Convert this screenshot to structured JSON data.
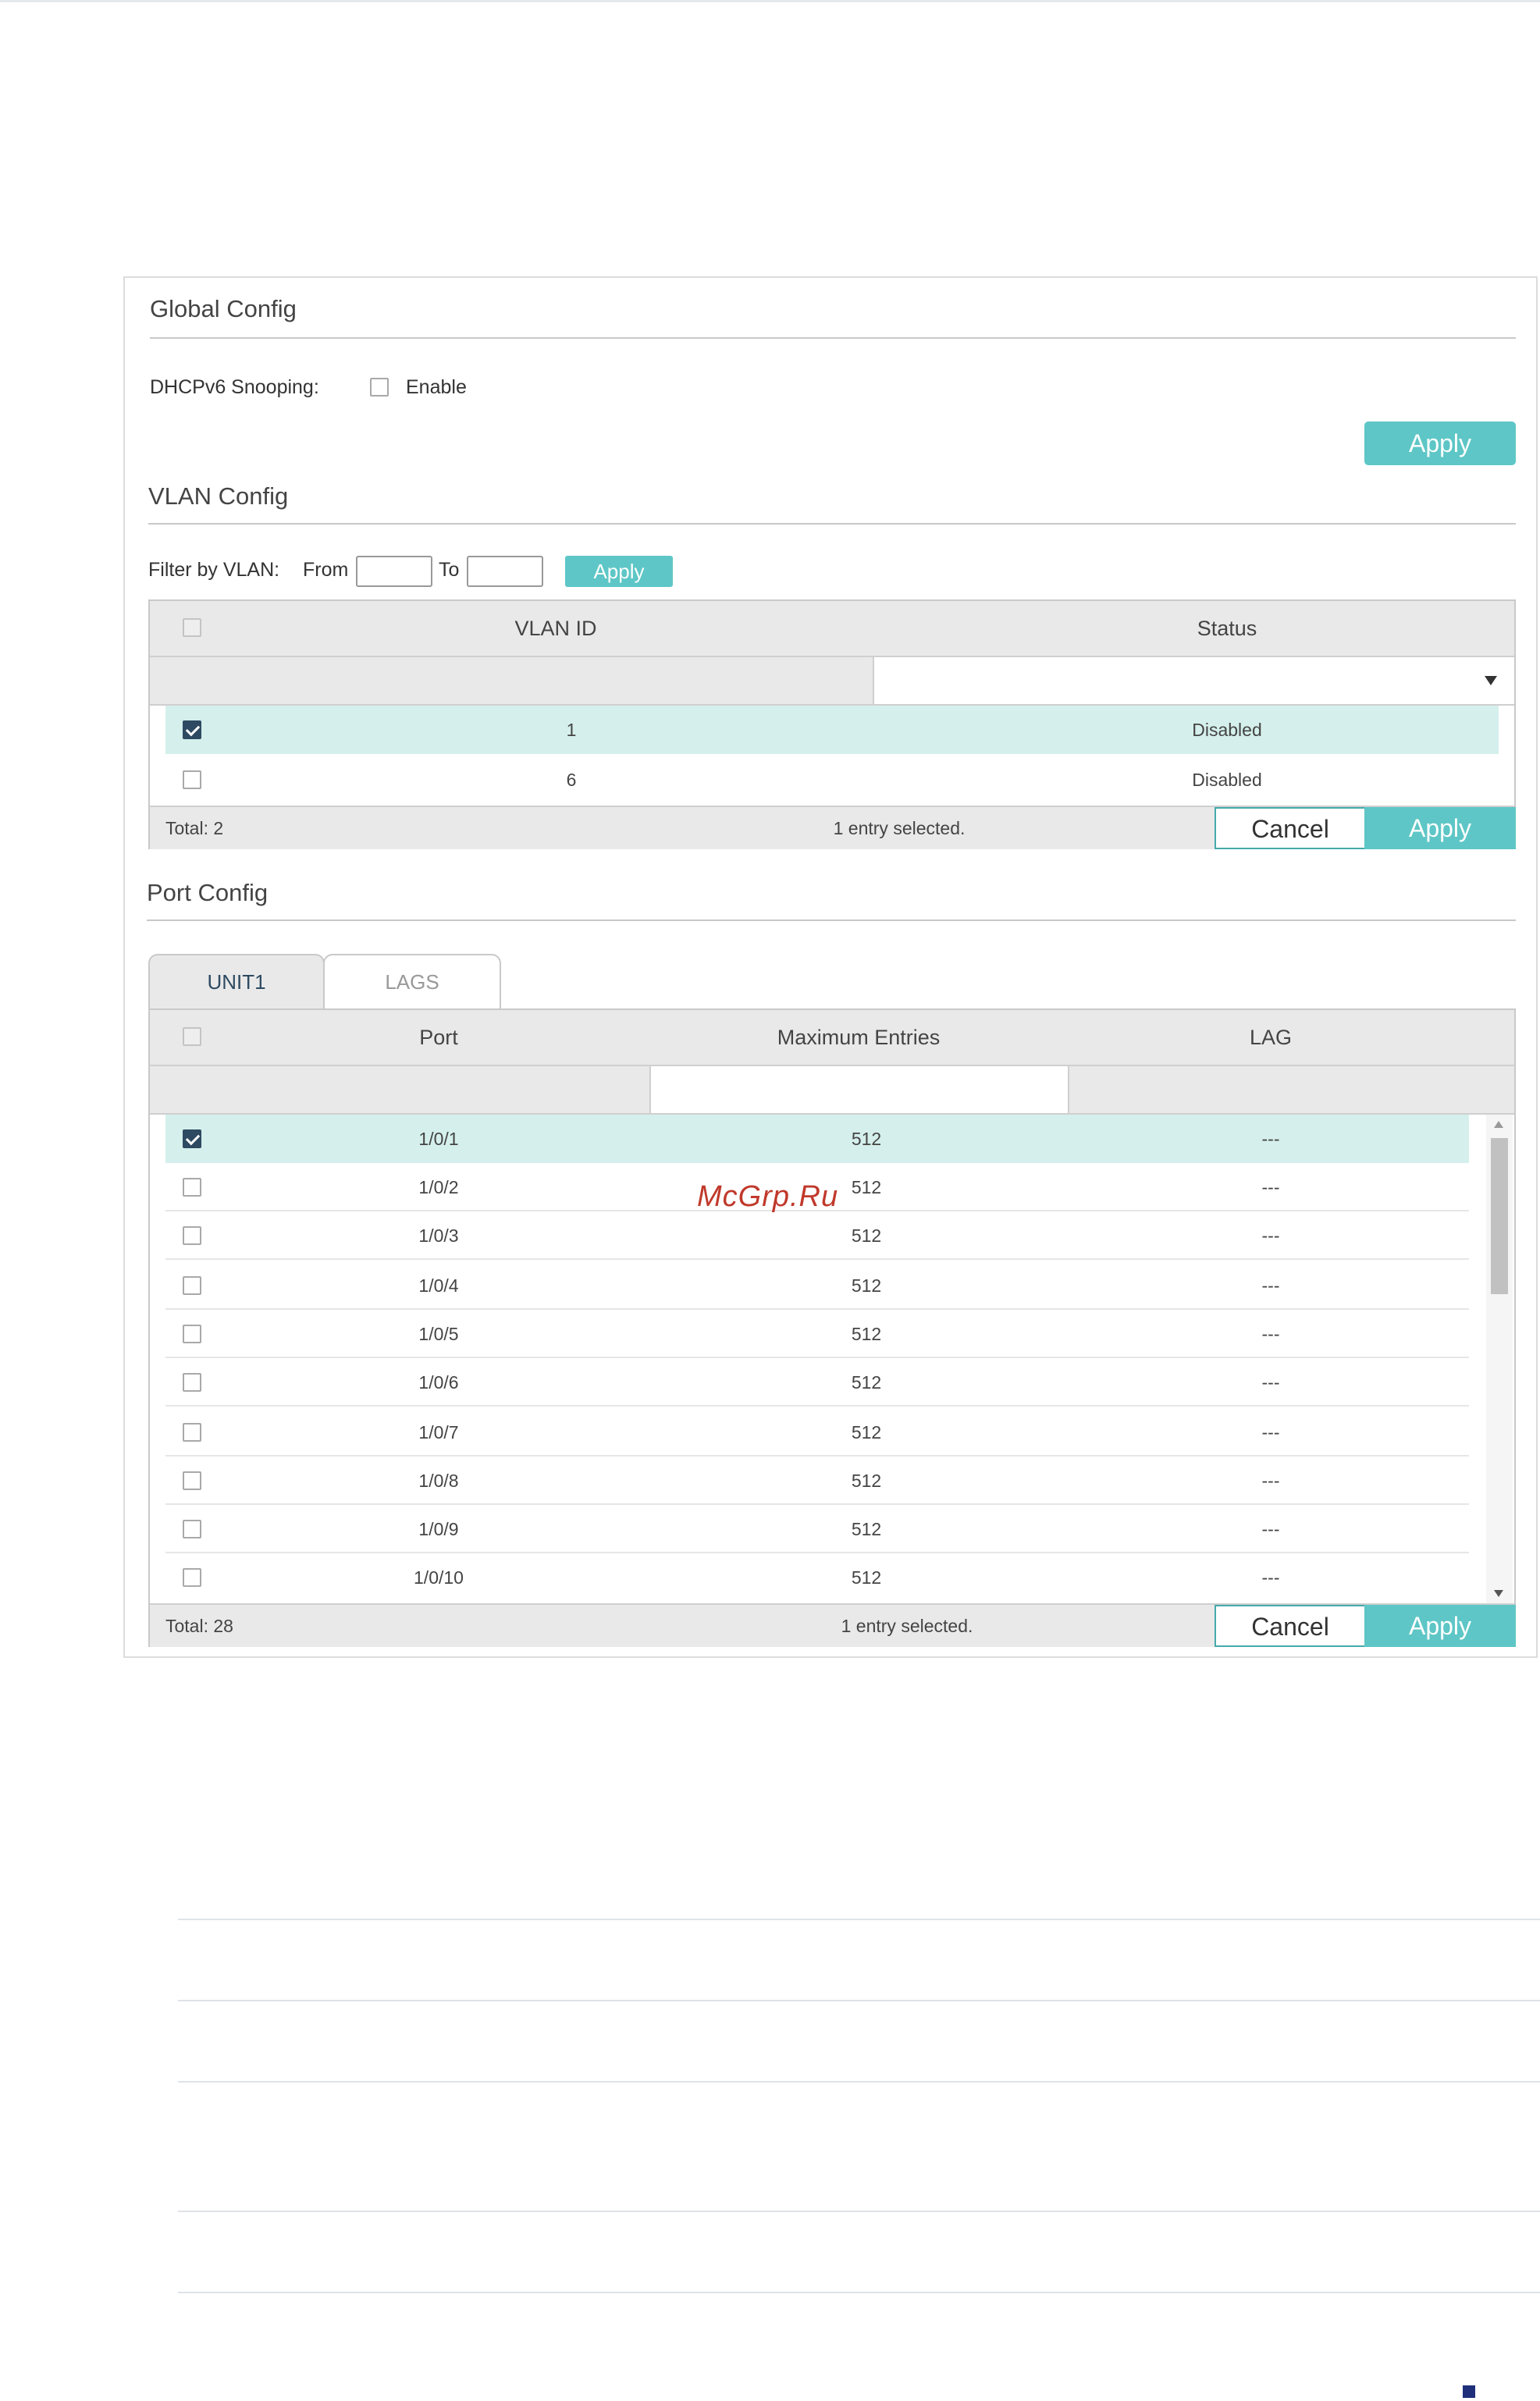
{
  "global_config": {
    "title": "Global Config",
    "dhcpv6_label": "DHCPv6 Snooping:",
    "enable_label": "Enable",
    "enable_checked": false,
    "apply_label": "Apply"
  },
  "vlan_config": {
    "title": "VLAN Config",
    "filter_label": "Filter by VLAN:",
    "from_label": "From",
    "to_label": "To",
    "from_value": "",
    "to_value": "",
    "filter_apply_label": "Apply",
    "columns": [
      "VLAN ID",
      "Status"
    ],
    "rows": [
      {
        "vlan_id": "1",
        "status": "Disabled",
        "selected": true
      },
      {
        "vlan_id": "6",
        "status": "Disabled",
        "selected": false
      }
    ],
    "footer": {
      "total": "Total: 2",
      "selected_text": "1 entry selected.",
      "cancel_label": "Cancel",
      "apply_label": "Apply"
    }
  },
  "port_config": {
    "title": "Port Config",
    "tabs": [
      {
        "label": "UNIT1",
        "active": true
      },
      {
        "label": "LAGS",
        "active": false
      }
    ],
    "columns": [
      "Port",
      "Maximum Entries",
      "LAG"
    ],
    "rows": [
      {
        "port": "1/0/1",
        "max": "512",
        "lag": "---",
        "selected": true
      },
      {
        "port": "1/0/2",
        "max": "512",
        "lag": "---",
        "selected": false
      },
      {
        "port": "1/0/3",
        "max": "512",
        "lag": "---",
        "selected": false
      },
      {
        "port": "1/0/4",
        "max": "512",
        "lag": "---",
        "selected": false
      },
      {
        "port": "1/0/5",
        "max": "512",
        "lag": "---",
        "selected": false
      },
      {
        "port": "1/0/6",
        "max": "512",
        "lag": "---",
        "selected": false
      },
      {
        "port": "1/0/7",
        "max": "512",
        "lag": "---",
        "selected": false
      },
      {
        "port": "1/0/8",
        "max": "512",
        "lag": "---",
        "selected": false
      },
      {
        "port": "1/0/9",
        "max": "512",
        "lag": "---",
        "selected": false
      },
      {
        "port": "1/0/10",
        "max": "512",
        "lag": "---",
        "selected": false
      }
    ],
    "footer": {
      "total": "Total: 28",
      "selected_text": "1 entry selected.",
      "cancel_label": "Cancel",
      "apply_label": "Apply"
    }
  },
  "watermark": "McGrp.Ru",
  "colors": {
    "accent": "#5ec6c6",
    "selected_row": "#d5f0ec",
    "checkbox_checked": "#2e4a62"
  }
}
